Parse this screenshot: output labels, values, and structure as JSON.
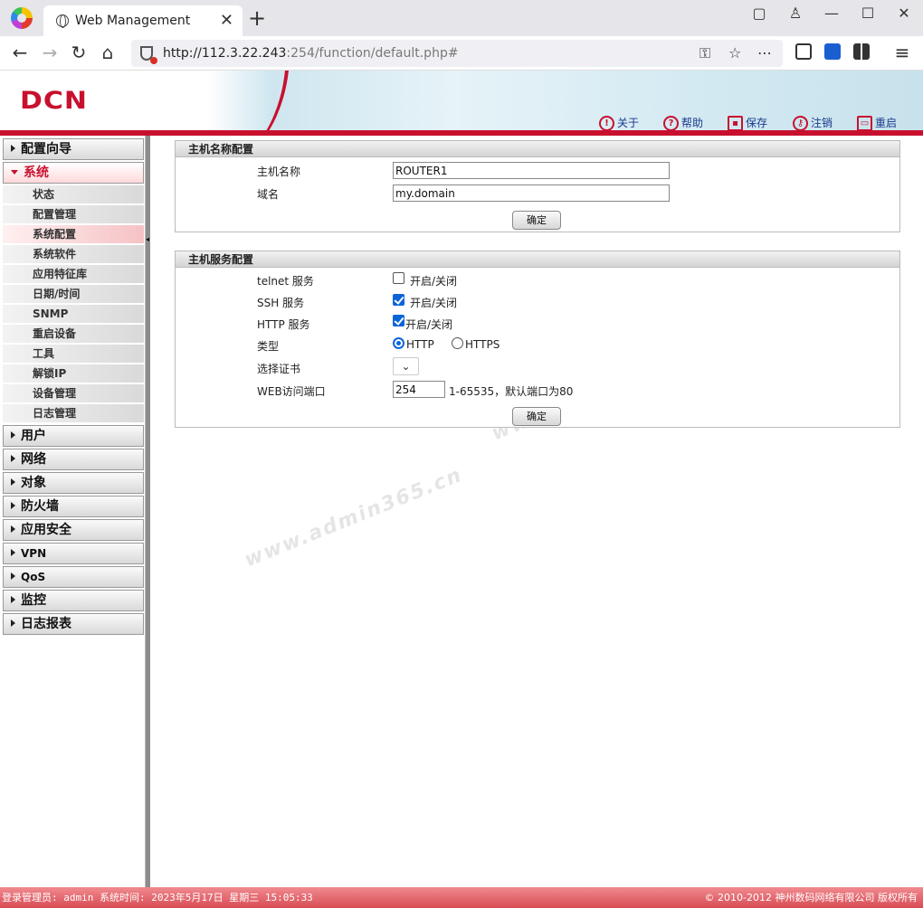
{
  "browser": {
    "tab_title": "Web Management",
    "url_host": "http://112.3.22.243",
    "url_rest": ":254/function/default.php#"
  },
  "header": {
    "brand": "DCN",
    "links": {
      "about": "关于",
      "help": "帮助",
      "save": "保存",
      "logout": "注销",
      "reboot": "重启"
    }
  },
  "sidebar": {
    "config_wizard": "配置向导",
    "system": "系统",
    "system_items": [
      "状态",
      "配置管理",
      "系统配置",
      "系统软件",
      "应用特征库",
      "日期/时间",
      "SNMP",
      "重启设备",
      "工具",
      "解锁IP",
      "设备管理",
      "日志管理"
    ],
    "user": "用户",
    "network": "网络",
    "object": "对象",
    "firewall": "防火墙",
    "app_security": "应用安全",
    "vpn": "VPN",
    "qos": "QoS",
    "monitor": "监控",
    "log_report": "日志报表"
  },
  "hostname_panel": {
    "title": "主机名称配置",
    "hostname_label": "主机名称",
    "hostname_value": "ROUTER1",
    "domain_label": "域名",
    "domain_value": "my.domain",
    "confirm": "确定"
  },
  "service_panel": {
    "title": "主机服务配置",
    "telnet_label": "telnet 服务",
    "telnet_toggle": "开启/关闭",
    "telnet_enabled": false,
    "ssh_label": "SSH 服务",
    "ssh_toggle": "开启/关闭",
    "ssh_enabled": true,
    "http_label": "HTTP 服务",
    "http_toggle": "开启/关闭",
    "http_enabled": true,
    "type_label": "类型",
    "type_http": "HTTP",
    "type_https": "HTTPS",
    "type_selected": "HTTP",
    "cert_label": "选择证书",
    "port_label": "WEB访问端口",
    "port_value": "254",
    "port_hint": "1-65535，默认端口为80",
    "confirm": "确定"
  },
  "watermark": {
    "text1": "www.admin365.cn",
    "text2": "www.admin365.cn"
  },
  "statusbar": {
    "left": "登录管理员: admin 系统时间: 2023年5月17日 星期三 15:05:33",
    "right": "© 2010-2012 神州数码网络有限公司 版权所有"
  }
}
